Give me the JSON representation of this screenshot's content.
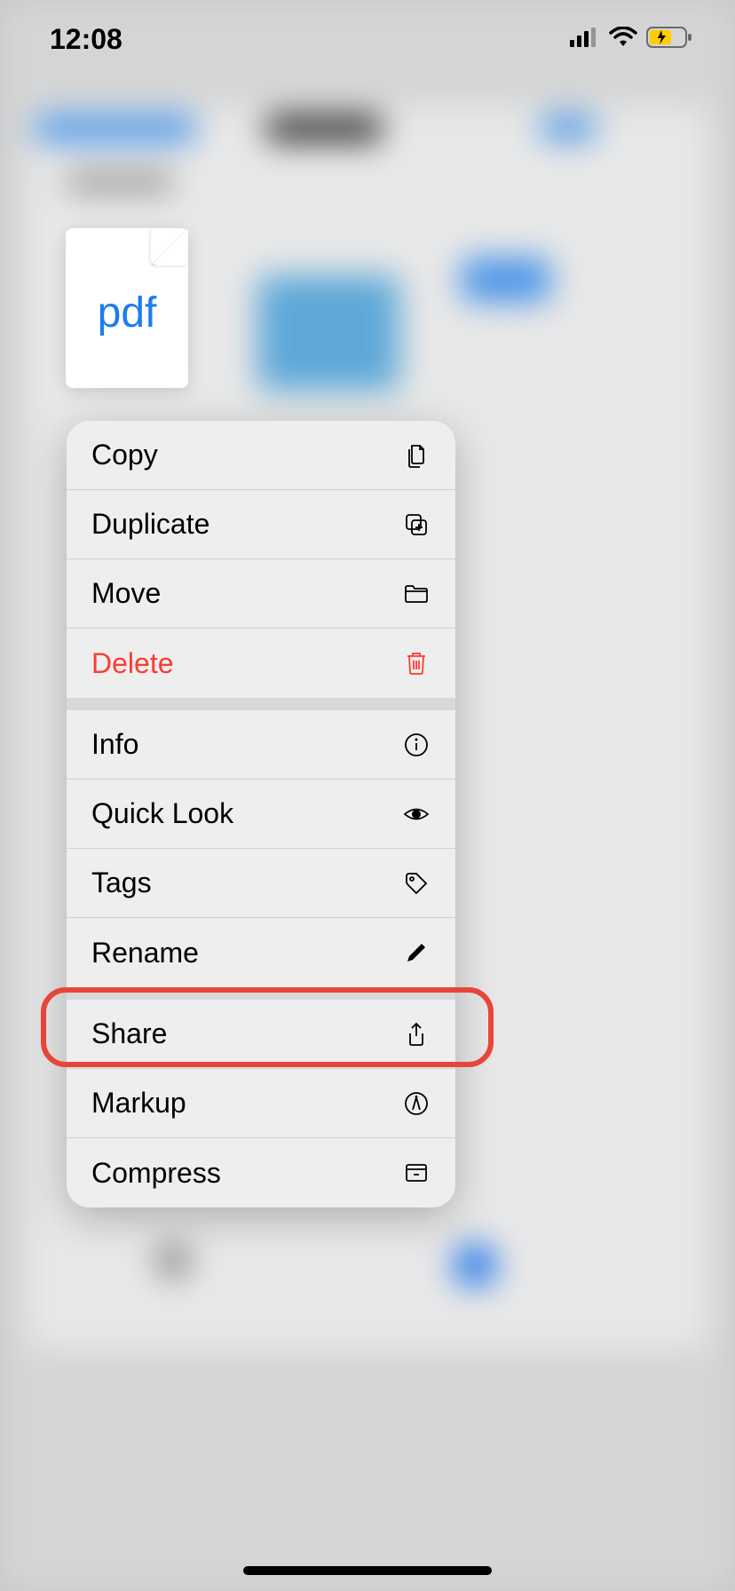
{
  "status_bar": {
    "time": "12:08"
  },
  "file_preview": {
    "type_label": "pdf"
  },
  "context_menu": {
    "groups": [
      {
        "items": [
          {
            "label": "Copy",
            "icon": "copy-icon",
            "destructive": false
          },
          {
            "label": "Duplicate",
            "icon": "duplicate-icon",
            "destructive": false
          },
          {
            "label": "Move",
            "icon": "folder-icon",
            "destructive": false
          },
          {
            "label": "Delete",
            "icon": "trash-icon",
            "destructive": true
          }
        ]
      },
      {
        "items": [
          {
            "label": "Info",
            "icon": "info-icon",
            "destructive": false
          },
          {
            "label": "Quick Look",
            "icon": "eye-icon",
            "destructive": false
          },
          {
            "label": "Tags",
            "icon": "tag-icon",
            "destructive": false
          },
          {
            "label": "Rename",
            "icon": "pencil-icon",
            "destructive": false
          }
        ]
      },
      {
        "items": [
          {
            "label": "Share",
            "icon": "share-icon",
            "destructive": false
          },
          {
            "label": "Markup",
            "icon": "markup-icon",
            "destructive": false
          },
          {
            "label": "Compress",
            "icon": "archive-icon",
            "destructive": false
          }
        ]
      }
    ]
  },
  "highlighted_item_label": "Share"
}
